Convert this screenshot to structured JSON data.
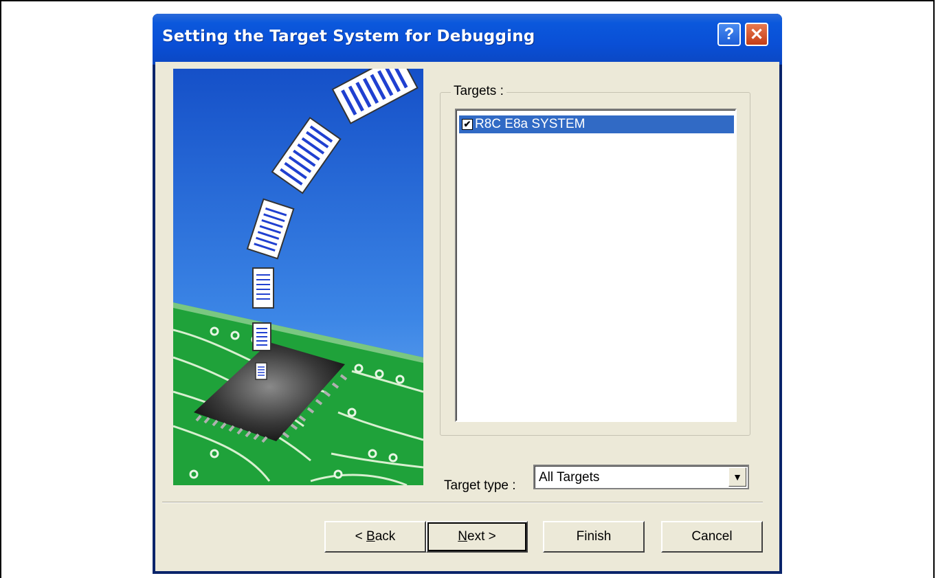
{
  "dialog": {
    "title": "Setting the Target System for Debugging",
    "help_glyph": "?",
    "close_glyph": "✕"
  },
  "targets": {
    "group_label": "Targets :",
    "items": [
      {
        "label": "R8C E8a SYSTEM",
        "checked": true,
        "selected": true
      }
    ]
  },
  "target_type": {
    "label": "Target type :",
    "value": "All Targets"
  },
  "buttons": {
    "back": {
      "prefix": "< ",
      "mnemonic": "B",
      "rest": "ack"
    },
    "next": {
      "mnemonic": "N",
      "rest": "ext >"
    },
    "finish": "Finish",
    "cancel": "Cancel"
  },
  "colors": {
    "titlebar": "#0a4fd6",
    "selection": "#316ac5",
    "dialog_bg": "#ece9d8",
    "sky_top": "#1550c8",
    "board_green": "#1fa23a"
  }
}
